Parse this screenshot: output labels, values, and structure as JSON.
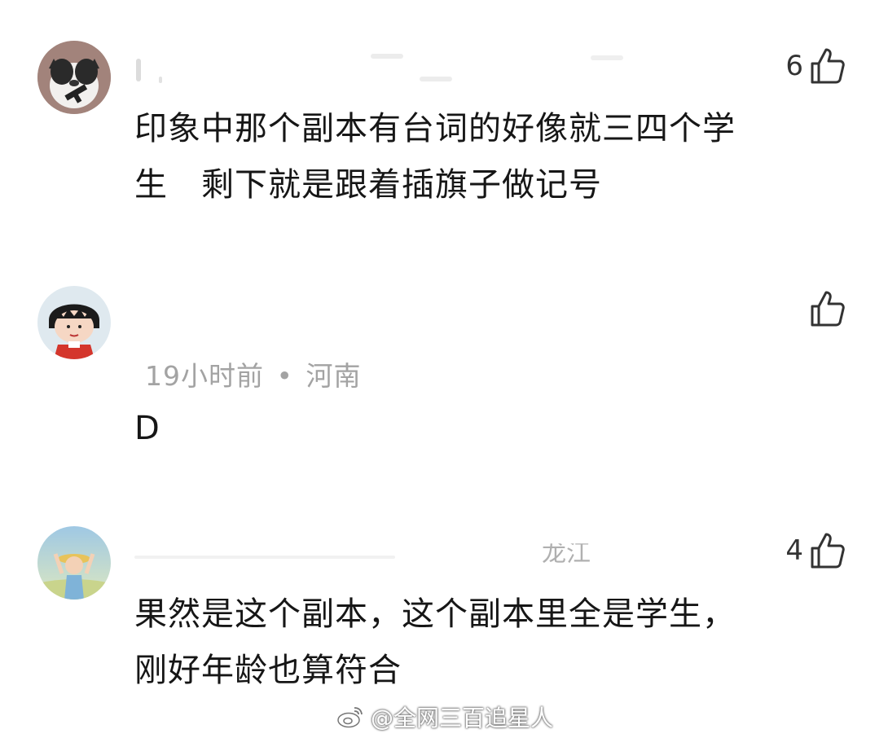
{
  "comments": [
    {
      "avatar": "cat-avatar",
      "username": "",
      "like_count": "6",
      "text_line1": "印象中那个副本有台词的好像就三四个学",
      "text_line2": "生　剩下就是跟着插旗子做记号"
    },
    {
      "avatar": "girl-cartoon-avatar",
      "like_count": "",
      "time": "19小时前",
      "separator": "•",
      "location": "河南",
      "text_line1": "D"
    },
    {
      "avatar": "child-sky-avatar",
      "location_partial": "龙江",
      "like_count": "4",
      "text_line1": "果然是这个副本，这个副本里全是学生，",
      "text_line2": "刚好年龄也算符合"
    }
  ],
  "watermark": {
    "text": "@全网三百追星人",
    "icon": "weibo-icon"
  }
}
